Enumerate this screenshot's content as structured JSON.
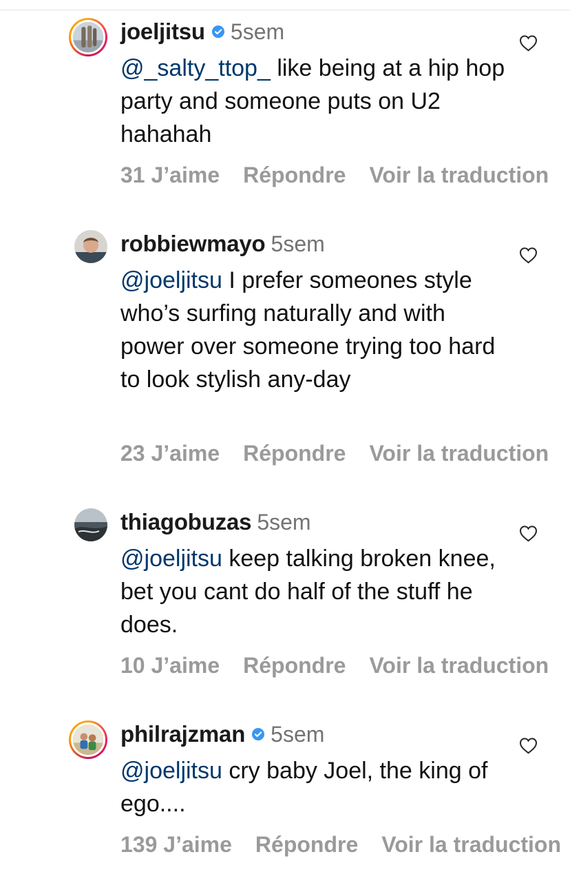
{
  "comments": [
    {
      "username": "joeljitsu",
      "verified": true,
      "time": "5sem",
      "mention": "@_salty_ttop_",
      "text": " like being at a hip hop party and someone puts on U2 hahahah",
      "likes": "31 J’aime",
      "reply": "Répondre",
      "translate": "Voir la traduction"
    },
    {
      "username": "robbiewmayo",
      "verified": false,
      "time": "5sem",
      "mention": "@joeljitsu",
      "text": " I prefer someones style who’s surfing naturally and with power over someone trying too hard to look stylish any-day",
      "likes": "23 J’aime",
      "reply": "Répondre",
      "translate": "Voir la traduction"
    },
    {
      "username": "thiagobuzas",
      "verified": false,
      "time": "5sem",
      "mention": "@joeljitsu",
      "text": " keep talking broken knee, bet you cant do half of the stuff he does.",
      "likes": "10 J’aime",
      "reply": "Répondre",
      "translate": "Voir la traduction"
    },
    {
      "username": "philrajzman",
      "verified": true,
      "time": "5sem",
      "mention": "@joeljitsu",
      "text": " cry baby Joel, the king of ego....",
      "likes": "139 J’aime",
      "reply": "Répondre",
      "translate": "Voir la traduction"
    }
  ],
  "icons": {
    "like": "heart-outline-icon",
    "verified": "verified-badge-icon"
  },
  "colors": {
    "mention": "#00376b",
    "verified": "#3897f0",
    "secondary_text": "#737373",
    "action_text": "#9a9a9a"
  }
}
